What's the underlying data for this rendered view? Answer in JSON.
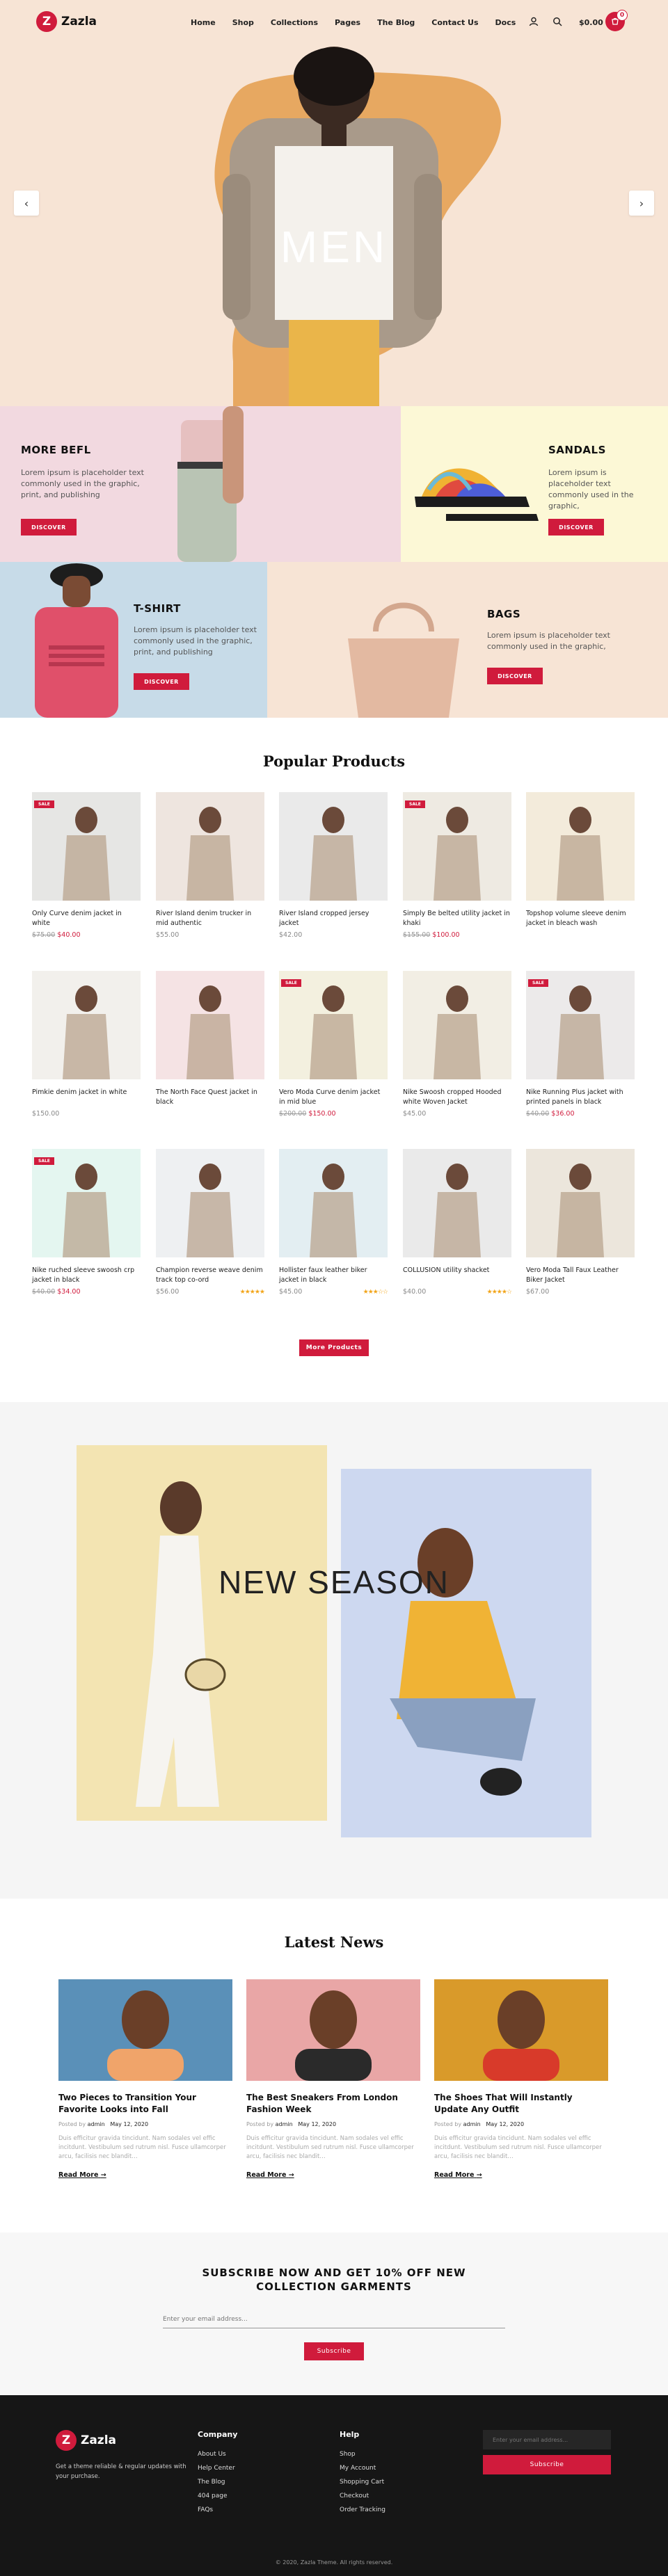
{
  "header": {
    "logo_mark": "Z",
    "logo_text": "Zazla",
    "nav": [
      "Home",
      "Shop",
      "Collections",
      "Pages",
      "The Blog",
      "Contact Us",
      "Docs"
    ],
    "cart_total": "$0.00",
    "cart_count": "0",
    "icons": [
      "user-icon",
      "search-icon",
      "cart-icon"
    ]
  },
  "hero": {
    "title": "MEN",
    "prev_icon": "‹",
    "next_icon": "›"
  },
  "banners": [
    {
      "title": "MORE BEFL",
      "text": "Lorem ipsum is placeholder text commonly used in the graphic, print, and publishing",
      "button": "DISCOVER",
      "bg": "#f2d9e0"
    },
    {
      "title": "SANDALS",
      "text": "Lorem ipsum is placeholder text commonly used in the graphic,",
      "button": "DISCOVER",
      "bg": "#fcf8d6"
    },
    {
      "title": "T-SHIRT",
      "text": "Lorem ipsum is placeholder text commonly used in the graphic, print, and publishing",
      "button": "DISCOVER",
      "bg": "#c7dbe8"
    },
    {
      "title": "BAGS",
      "text": "Lorem ipsum is placeholder text commonly used in the graphic,",
      "button": "DISCOVER",
      "bg": "#f7e4d5"
    }
  ],
  "popular": {
    "title": "Popular Products",
    "more_button": "More Products",
    "products": [
      {
        "name": "Only Curve denim jacket in white",
        "old": "$75.00",
        "price": "$40.00",
        "sale": "SALE",
        "bg": "#e6e6e4"
      },
      {
        "name": "River Island denim trucker in mid authentic",
        "old": "",
        "price": "$55.00",
        "sale": "",
        "bg": "#eee5df"
      },
      {
        "name": "River Island cropped jersey jacket",
        "old": "",
        "price": "$42.00",
        "sale": "",
        "bg": "#eaeaea"
      },
      {
        "name": "Simply Be belted utility jacket in khaki",
        "old": "$155.00",
        "price": "$100.00",
        "sale": "SALE",
        "bg": "#eeeae2"
      },
      {
        "name": "Topshop volume sleeve denim jacket in bleach wash",
        "old": "",
        "price": "",
        "sale": "",
        "bg": "#f3ebdb"
      },
      {
        "name": "Pimkie denim jacket in white",
        "old": "",
        "price": "$150.00",
        "sale": "",
        "bg": "#f2f0ec"
      },
      {
        "name": "The North Face Quest jacket in black",
        "old": "",
        "price": "",
        "sale": "",
        "bg": "#f5e3e4"
      },
      {
        "name": "Vero Moda Curve denim jacket in mid blue",
        "old": "$200.00",
        "price": "$150.00",
        "sale": "SALE",
        "bg": "#f3f0df"
      },
      {
        "name": "Nike Swoosh cropped Hooded white Woven Jacket",
        "old": "",
        "price": "$45.00",
        "sale": "",
        "bg": "#f2eee4"
      },
      {
        "name": "Nike Running Plus jacket with printed panels in black",
        "old": "$40.00",
        "price": "$36.00",
        "sale": "SALE",
        "bg": "#eceaea"
      },
      {
        "name": "Nike ruched sleeve swoosh crp jacket in black",
        "old": "$40.00",
        "price": "$34.00",
        "sale": "SALE",
        "bg": "#e4f6f0"
      },
      {
        "name": "Champion reverse weave denim track top co-ord",
        "old": "",
        "price": "$56.00",
        "sale": "",
        "bg": "#eef0f2",
        "stars": "★★★★★"
      },
      {
        "name": "Hollister faux leather biker jacket in black",
        "old": "",
        "price": "$45.00",
        "sale": "",
        "bg": "#e3eef2",
        "stars": "★★★☆☆"
      },
      {
        "name": "COLLUSION utility shacket",
        "old": "",
        "price": "$40.00",
        "sale": "",
        "bg": "#eaeaea",
        "stars": "★★★★☆"
      },
      {
        "name": "Vero Moda Tall Faux Leather Biker Jacket",
        "old": "",
        "price": "$67.00",
        "sale": "",
        "bg": "#ece6dc"
      }
    ]
  },
  "new_season": {
    "title": "NEW SEASON"
  },
  "news": {
    "title": "Latest News",
    "items": [
      {
        "title": "Two Pieces to Transition Your Favorite Looks into Fall",
        "posted_by": "Posted by",
        "author": "admin",
        "date": "May 12, 2020",
        "excerpt": "Duis efficitur gravida tincidunt. Nam sodales vel effic incitdunt. Vestibulum sed rutrum nisl. Fusce ullamcorper arcu, facilisis nec blandit…",
        "more": "Read More"
      },
      {
        "title": "The Best Sneakers From London Fashion Week",
        "posted_by": "Posted by",
        "author": "admin",
        "date": "May 12, 2020",
        "excerpt": "Duis efficitur gravida tincidunt. Nam sodales vel effic incitdunt. Vestibulum sed rutrum nisl. Fusce ullamcorper arcu, facilisis nec blandit…",
        "more": "Read More"
      },
      {
        "title": "The Shoes That Will Instantly Update Any Outfit",
        "posted_by": "Posted by",
        "author": "admin",
        "date": "May 12, 2020",
        "excerpt": "Duis efficitur gravida tincidunt. Nam sodales vel effic incitdunt. Vestibulum sed rutrum nisl. Fusce ullamcorper arcu, facilisis nec blandit…",
        "more": "Read More"
      }
    ]
  },
  "subscribe": {
    "title": "SUBSCRIBE NOW AND GET 10% OFF NEW COLLECTION GARMENTS",
    "placeholder": "Enter your email address...",
    "button": "Subscribe"
  },
  "footer": {
    "logo_mark": "Z",
    "logo_text": "Zazla",
    "about": "Get a theme reliable & regular updates with your purchase.",
    "company_title": "Company",
    "company_links": [
      "About Us",
      "Help Center",
      "The Blog",
      "404 page",
      "FAQs"
    ],
    "help_title": "Help",
    "help_links": [
      "Shop",
      "My Account",
      "Shopping Cart",
      "Checkout",
      "Order Tracking"
    ],
    "email_placeholder": "Enter your email address...",
    "subscribe_button": "Subscribe",
    "copyright": "© 2020, Zazla Theme. All rights reserved."
  },
  "colors": {
    "accent": "#d01b3c",
    "footer_bg": "#161616"
  }
}
